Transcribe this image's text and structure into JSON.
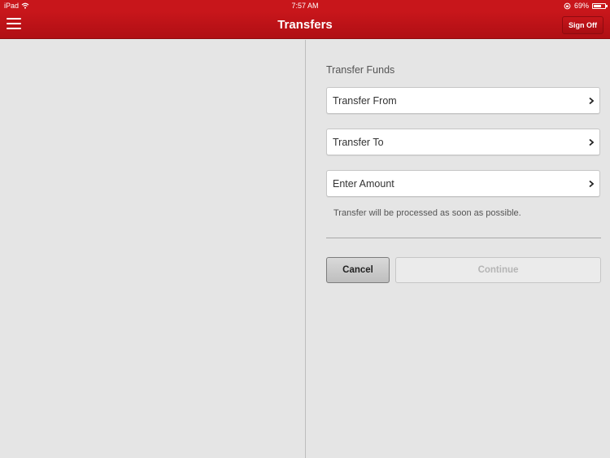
{
  "status_bar": {
    "device": "iPad",
    "time": "7:57 AM",
    "battery": "69%",
    "battery_level": 0.69,
    "icons": [
      "wifi-icon",
      "rotation-lock-icon",
      "battery-icon"
    ]
  },
  "nav": {
    "title": "Transfers",
    "sign_off_label": "Sign Off",
    "menu_icon": "hamburger-menu-icon"
  },
  "transfer": {
    "section_title": "Transfer Funds",
    "fields": [
      {
        "label": "Transfer From"
      },
      {
        "label": "Transfer To"
      },
      {
        "label": "Enter Amount"
      }
    ],
    "note": "Transfer will be processed as soon as possible.",
    "cancel_label": "Cancel",
    "continue_label": "Continue",
    "continue_enabled": false
  },
  "colors": {
    "brand_red": "#c8161b",
    "background": "#e5e5e5"
  }
}
